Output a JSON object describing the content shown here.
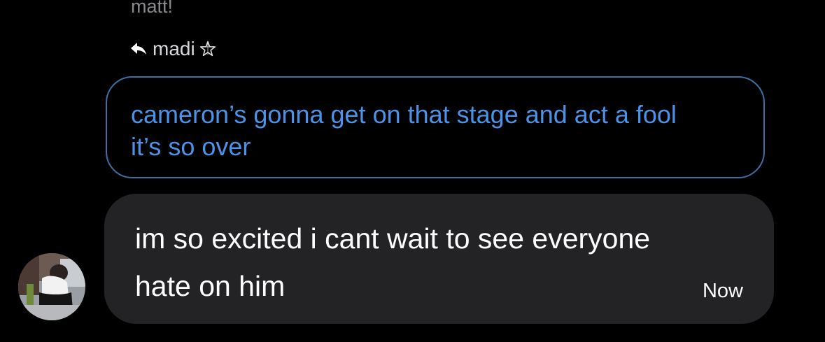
{
  "previous_message": {
    "sender_name": "matt!"
  },
  "reply_context": {
    "icon": "reply-arrow-icon",
    "replying_to": "madi",
    "badge_icon": "star-icon",
    "quoted_text": "cameron’s gonna get on that stage and act a fool\nit’s so over"
  },
  "message": {
    "avatar_icon": "avatar-photo",
    "text": "im so excited i cant wait to see everyone\nhate on him",
    "timestamp": "Now"
  },
  "colors": {
    "background": "#000000",
    "quoted_text": "#4b93e8",
    "quoted_border": "#3e6fa6",
    "bubble": "#232326",
    "muted_text": "#8a8a8e"
  }
}
